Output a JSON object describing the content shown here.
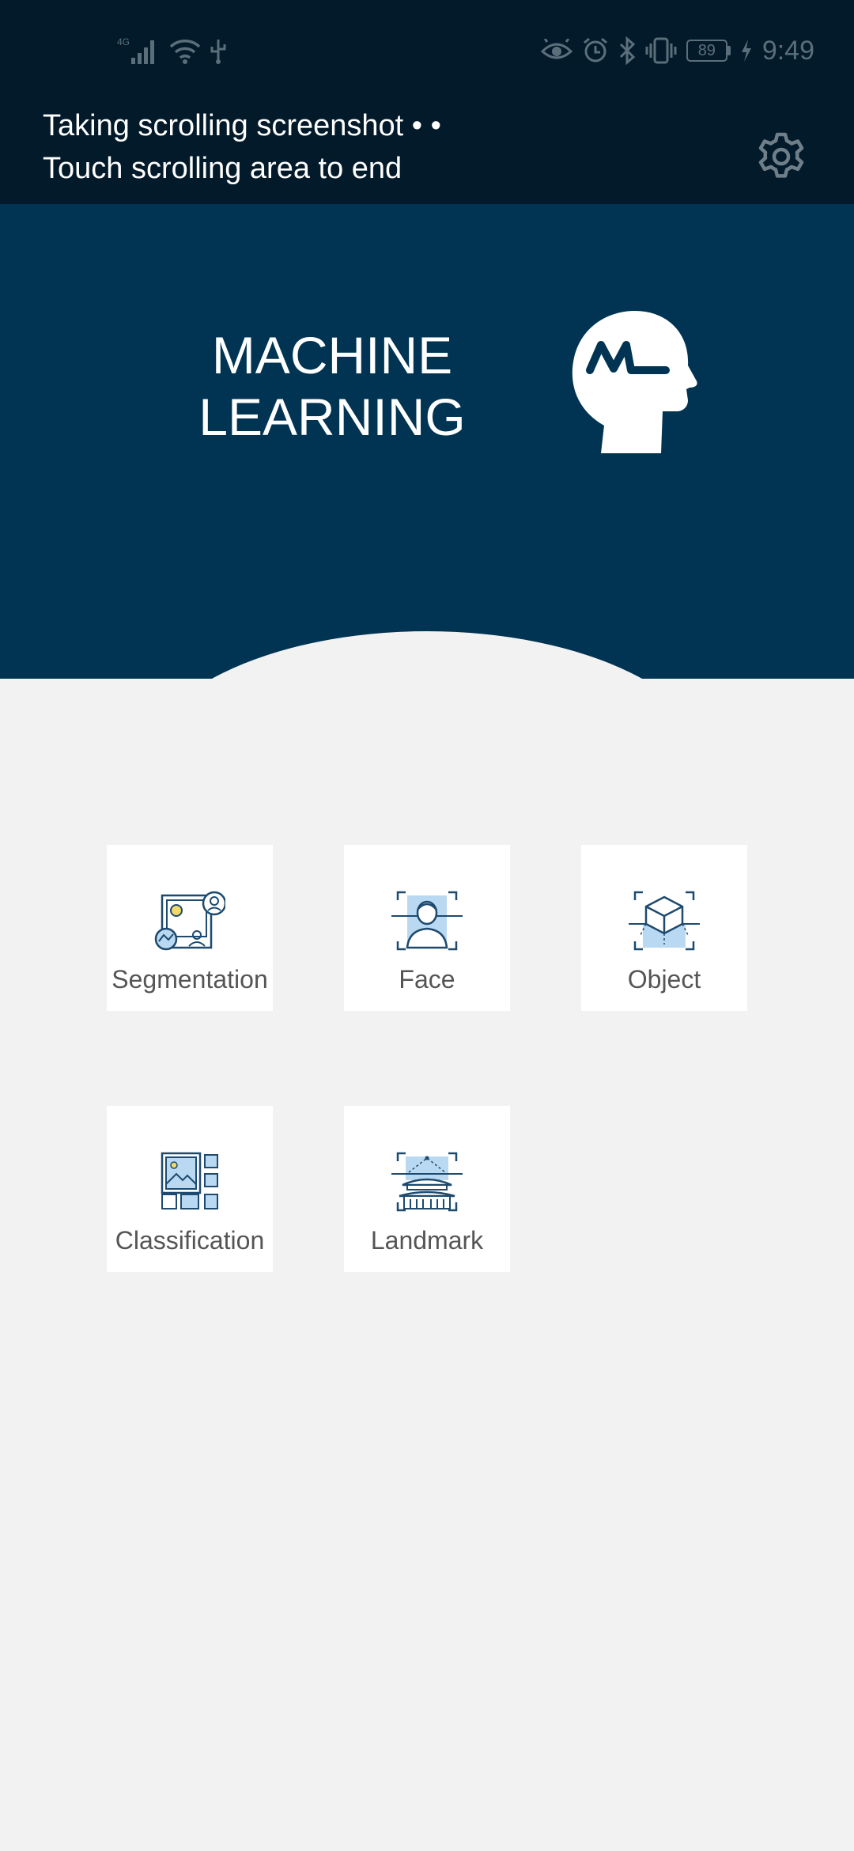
{
  "status_bar": {
    "network_label": "4G",
    "battery_level": "89",
    "time": "9:49",
    "icons": [
      "signal-icon",
      "wifi-icon",
      "usb-icon",
      "eye-comfort-icon",
      "alarm-icon",
      "bluetooth-icon",
      "vibrate-icon",
      "battery-icon",
      "charging-icon"
    ]
  },
  "screenshot_overlay": {
    "line1": "Taking scrolling screenshot • •",
    "line2": "Touch scrolling area to end",
    "settings_icon": "gear-icon"
  },
  "hero": {
    "title_line1": "MACHINE",
    "title_line2": "LEARNING",
    "logo_text": "ML",
    "background_color": "#003452"
  },
  "features": [
    {
      "label": "Segmentation",
      "icon": "segmentation-icon"
    },
    {
      "label": "Face",
      "icon": "face-icon"
    },
    {
      "label": "Object",
      "icon": "object-icon"
    },
    {
      "label": "Classification",
      "icon": "classification-icon"
    },
    {
      "label": "Landmark",
      "icon": "landmark-icon"
    }
  ],
  "colors": {
    "accent_blue": "#1d5a8a",
    "icon_fill_light": "#b9d9f2",
    "page_background": "#f2f2f2"
  }
}
